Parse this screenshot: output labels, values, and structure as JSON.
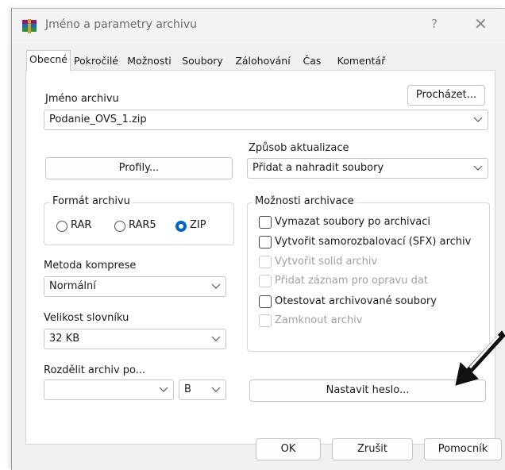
{
  "window": {
    "title": "Jméno a parametry archivu",
    "help": "?",
    "close": "✕"
  },
  "tabs": [
    "Obecné",
    "Pokročilé",
    "Možnosti",
    "Soubory",
    "Zálohování",
    "Čas",
    "Komentář"
  ],
  "archive_name": {
    "label": "Jméno archivu",
    "browse": "Procházet...",
    "value": "Podanie_OVS_1.zip"
  },
  "profiles": {
    "label": "Profily..."
  },
  "update_mode": {
    "label": "Způsob aktualizace",
    "value": "Přidat a nahradit soubory"
  },
  "format": {
    "label": "Formát archivu",
    "options": [
      "RAR",
      "RAR5",
      "ZIP"
    ],
    "selected": "ZIP"
  },
  "compression": {
    "label": "Metoda komprese",
    "value": "Normální"
  },
  "dictionary": {
    "label": "Velikost slovníku",
    "value": "32 KB"
  },
  "split": {
    "label": "Rozdělit archiv po...",
    "value": "",
    "unit": "B"
  },
  "options": {
    "label": "Možnosti archivace",
    "items": [
      {
        "text": "Vymazat soubory po archivaci",
        "enabled": true
      },
      {
        "text": "Vytvořit samorozbalovací (SFX) archiv",
        "enabled": true
      },
      {
        "text": "Vytvořit solid archiv",
        "enabled": false
      },
      {
        "text": "Přidat záznam pro opravu dat",
        "enabled": false
      },
      {
        "text": "Otestovat archivované soubory",
        "enabled": true
      },
      {
        "text": "Zamknout archiv",
        "enabled": false
      }
    ]
  },
  "set_password": "Nastavit heslo...",
  "footer": {
    "ok": "OK",
    "cancel": "Zrušit",
    "help": "Pomocník"
  },
  "colors": {
    "accent": "#0067c0",
    "window_bg": "#f0f0f0",
    "panel_bg": "#ffffff"
  }
}
